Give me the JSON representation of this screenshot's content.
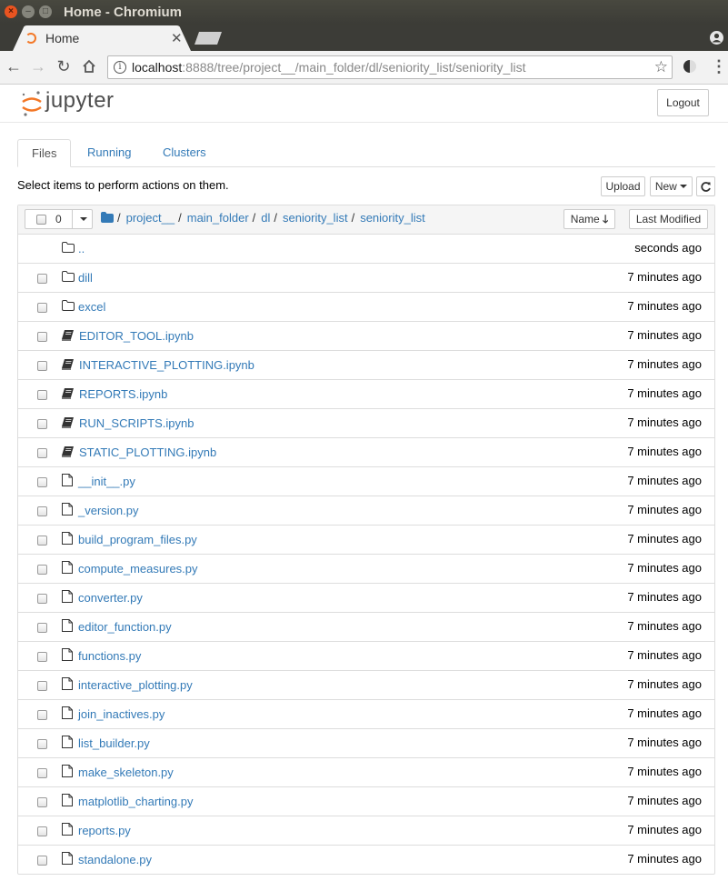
{
  "window": {
    "title": "Home - Chromium"
  },
  "browser": {
    "tab_title": "Home",
    "url_host": "localhost",
    "url_rest": ":8888/tree/project__/main_folder/dl/seniority_list/seniority_list"
  },
  "jupyter": {
    "logo_text": "jupyter",
    "logout_label": "Logout"
  },
  "tabs": [
    {
      "label": "Files"
    },
    {
      "label": "Running"
    },
    {
      "label": "Clusters"
    }
  ],
  "toolbar": {
    "hint": "Select items to perform actions on them.",
    "upload_label": "Upload",
    "new_label": "New",
    "refresh_icon": "refresh-icon"
  },
  "list": {
    "selected_count": "0",
    "breadcrumb": [
      "project__",
      "main_folder",
      "dl",
      "seniority_list",
      "seniority_list"
    ],
    "sort_name_label": "Name",
    "sort_modified_label": "Last Modified",
    "parent": {
      "name": "..",
      "time": "seconds ago"
    },
    "items": [
      {
        "type": "folder",
        "name": "dill",
        "time": "7 minutes ago"
      },
      {
        "type": "folder",
        "name": "excel",
        "time": "7 minutes ago"
      },
      {
        "type": "notebook",
        "name": "EDITOR_TOOL.ipynb",
        "time": "7 minutes ago"
      },
      {
        "type": "notebook",
        "name": "INTERACTIVE_PLOTTING.ipynb",
        "time": "7 minutes ago"
      },
      {
        "type": "notebook",
        "name": "REPORTS.ipynb",
        "time": "7 minutes ago"
      },
      {
        "type": "notebook",
        "name": "RUN_SCRIPTS.ipynb",
        "time": "7 minutes ago"
      },
      {
        "type": "notebook",
        "name": "STATIC_PLOTTING.ipynb",
        "time": "7 minutes ago"
      },
      {
        "type": "file",
        "name": "__init__.py",
        "time": "7 minutes ago"
      },
      {
        "type": "file",
        "name": "_version.py",
        "time": "7 minutes ago"
      },
      {
        "type": "file",
        "name": "build_program_files.py",
        "time": "7 minutes ago"
      },
      {
        "type": "file",
        "name": "compute_measures.py",
        "time": "7 minutes ago"
      },
      {
        "type": "file",
        "name": "converter.py",
        "time": "7 minutes ago"
      },
      {
        "type": "file",
        "name": "editor_function.py",
        "time": "7 minutes ago"
      },
      {
        "type": "file",
        "name": "functions.py",
        "time": "7 minutes ago"
      },
      {
        "type": "file",
        "name": "interactive_plotting.py",
        "time": "7 minutes ago"
      },
      {
        "type": "file",
        "name": "join_inactives.py",
        "time": "7 minutes ago"
      },
      {
        "type": "file",
        "name": "list_builder.py",
        "time": "7 minutes ago"
      },
      {
        "type": "file",
        "name": "make_skeleton.py",
        "time": "7 minutes ago"
      },
      {
        "type": "file",
        "name": "matplotlib_charting.py",
        "time": "7 minutes ago"
      },
      {
        "type": "file",
        "name": "reports.py",
        "time": "7 minutes ago"
      },
      {
        "type": "file",
        "name": "standalone.py",
        "time": "7 minutes ago"
      }
    ]
  },
  "colors": {
    "link": "#337ab7",
    "accent": "#f37726",
    "titlebar": "#3c3b37"
  }
}
